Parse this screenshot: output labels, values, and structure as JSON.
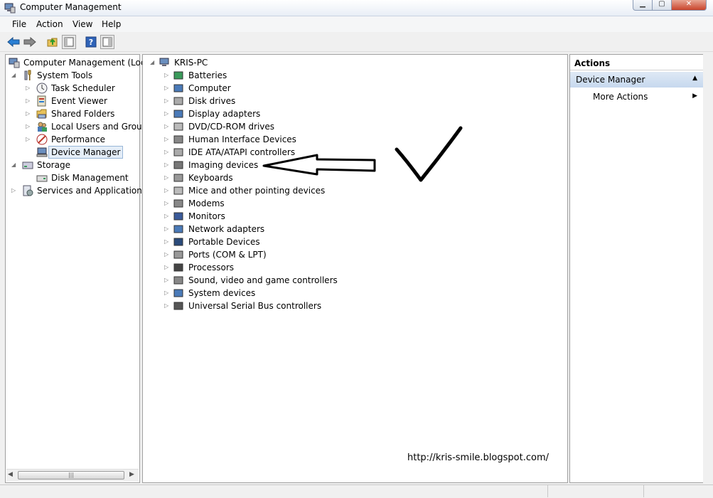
{
  "window": {
    "title": "Computer Management"
  },
  "menu": [
    "File",
    "Action",
    "View",
    "Help"
  ],
  "left_tree": [
    {
      "label": "Computer Management (Local",
      "icon": "computer-management-icon"
    },
    {
      "label": "System Tools",
      "icon": "tools-icon"
    },
    {
      "label": "Task Scheduler",
      "icon": "clock-icon"
    },
    {
      "label": "Event Viewer",
      "icon": "event-viewer-icon"
    },
    {
      "label": "Shared Folders",
      "icon": "shared-folders-icon"
    },
    {
      "label": "Local Users and Groups",
      "icon": "users-icon"
    },
    {
      "label": "Performance",
      "icon": "performance-icon"
    },
    {
      "label": "Device Manager",
      "icon": "device-manager-icon",
      "selected": true
    },
    {
      "label": "Storage",
      "icon": "storage-icon"
    },
    {
      "label": "Disk Management",
      "icon": "disk-management-icon"
    },
    {
      "label": "Services and Applications",
      "icon": "services-icon"
    }
  ],
  "device_tree": {
    "root": "KRIS-PC",
    "categories": [
      "Batteries",
      "Computer",
      "Disk drives",
      "Display adapters",
      "DVD/CD-ROM drives",
      "Human Interface Devices",
      "IDE ATA/ATAPI controllers",
      "Imaging devices",
      "Keyboards",
      "Mice and other pointing devices",
      "Modems",
      "Monitors",
      "Network adapters",
      "Portable Devices",
      "Ports (COM & LPT)",
      "Processors",
      "Sound, video and game controllers",
      "System devices",
      "Universal Serial Bus controllers"
    ]
  },
  "actions": {
    "header": "Actions",
    "section": "Device Manager",
    "more_actions": "More Actions"
  },
  "watermark": "http://kris-smile.blogspot.com/",
  "colors": {
    "selection_bg": "#e5eef8",
    "section_header": "#c6d8ee",
    "back_arrow": "#2a7fd4"
  }
}
